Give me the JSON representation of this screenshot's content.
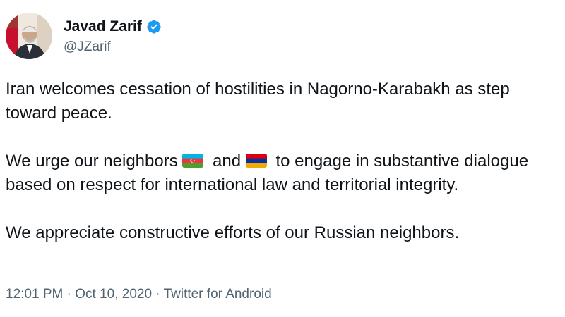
{
  "tweet": {
    "author": {
      "display_name": "Javad Zarif",
      "handle": "@JZarif",
      "avatar_icon": "profile-photo",
      "verified_icon": "verified-badge-icon",
      "verified_color": "#1d9bf0"
    },
    "paragraphs": {
      "p1": "Iran welcomes cessation of hostilities in Nagorno-Karabakh as step toward peace.",
      "p2_part1": "We urge our neighbors",
      "flag1_icon": "azerbaijan-flag-icon",
      "p2_and": "and",
      "flag2_icon": "armenia-flag-icon",
      "p2_part2": "to engage in substantive dialogue based on respect for international law and territorial integrity.",
      "p3": "We appreciate constructive efforts of our Russian neighbors."
    },
    "footer": {
      "time": "12:01 PM",
      "sep1": "·",
      "date": "Oct 10, 2020",
      "sep2": "·",
      "source": "Twitter for Android"
    }
  },
  "colors": {
    "text_primary": "#0f1419",
    "text_secondary": "#536471",
    "background": "#ffffff"
  }
}
